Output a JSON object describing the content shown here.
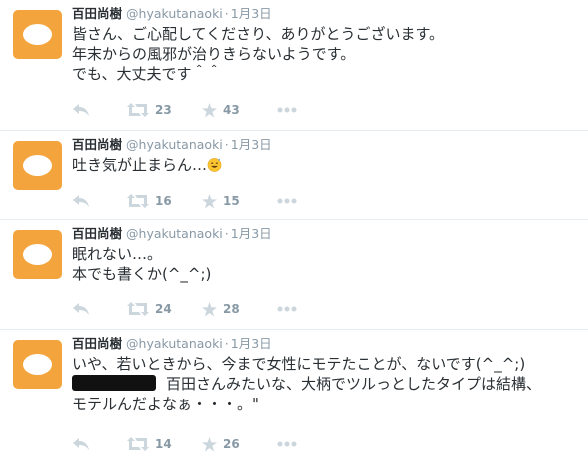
{
  "colors": {
    "avatar_bg": "#f4a43c",
    "text": "#292f33",
    "muted": "#8899a6",
    "divider": "#e6ecf0"
  },
  "icons": {
    "reply": "reply-arrow-icon",
    "retweet": "retweet-icon",
    "favorite": "star-icon",
    "more": "ellipsis-icon"
  },
  "tweets": [
    {
      "author": {
        "name": "百田尚樹",
        "handle": "@hyakutanaoki"
      },
      "separator": "·",
      "time": "1月3日",
      "lines": [
        "皆さん、ご心配してくださり、ありがとうございます。",
        "年末からの風邪が治りきらないようです。",
        "でも、大丈夫です＾＾"
      ],
      "retweets": "23",
      "favorites": "43"
    },
    {
      "author": {
        "name": "百田尚樹",
        "handle": "@hyakutanaoki"
      },
      "separator": "·",
      "time": "1月3日",
      "lines": [
        "吐き気が止まらん…"
      ],
      "retweets": "16",
      "favorites": "15"
    },
    {
      "author": {
        "name": "百田尚樹",
        "handle": "@hyakutanaoki"
      },
      "separator": "·",
      "time": "1月3日",
      "lines": [
        "眠れない…。",
        "本でも書くか(^_^;)"
      ],
      "retweets": "24",
      "favorites": "28"
    },
    {
      "author": {
        "name": "百田尚樹",
        "handle": "@hyakutanaoki"
      },
      "separator": "·",
      "time": "1月3日",
      "lines": [
        "いや、若いときから、今まで女性にモテたことが、ないです(^_^;)",
        "百田さんみたいな、大柄でツルっとしたタイプは結構、",
        "モテルんだよなぁ・・・。\""
      ],
      "retweets": "14",
      "favorites": "26"
    }
  ]
}
